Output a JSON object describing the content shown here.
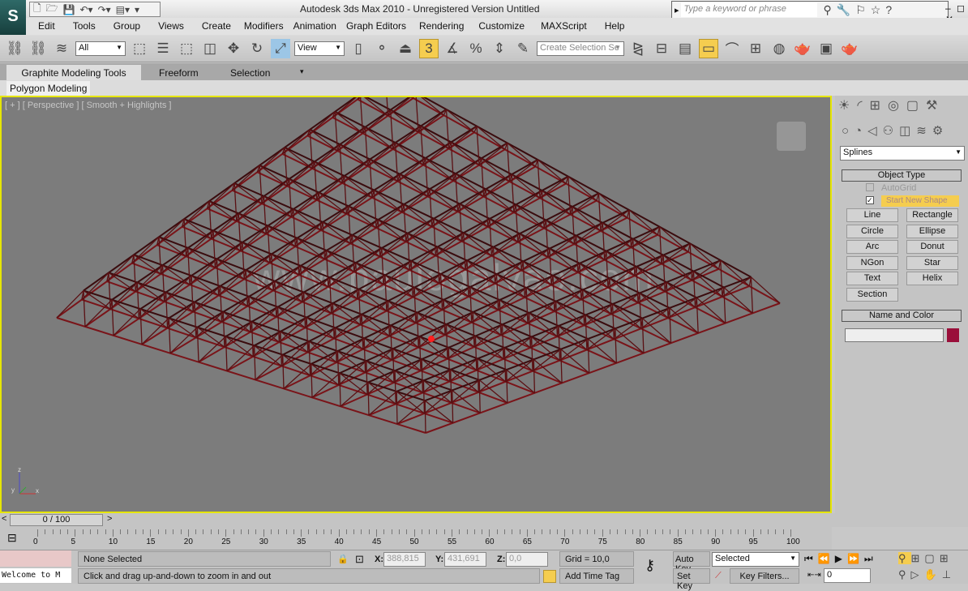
{
  "app": {
    "logo_text": "S",
    "title": "Autodesk 3ds Max  2010  -  Unregistered Version    Untitled",
    "search_placeholder": "Type a keyword or phrase",
    "window_controls": "–  ◻  ✕"
  },
  "quick_access": [
    "new-icon",
    "open-icon",
    "save-icon",
    "undo-icon",
    "redo-icon",
    "project-icon"
  ],
  "menu": [
    "Edit",
    "Tools",
    "Group",
    "Views",
    "Create",
    "Modifiers",
    "Animation",
    "Graph Editors",
    "Rendering",
    "Customize",
    "MAXScript",
    "Help"
  ],
  "toolbar": {
    "selection_filter": "All",
    "ref_coord": "View",
    "snap_label": "3",
    "named_selection_placeholder": "Create Selection Se"
  },
  "ribbon": {
    "tabs": [
      "Graphite Modeling Tools",
      "Freeform",
      "Selection"
    ],
    "panel": "Polygon Modeling"
  },
  "viewport": {
    "label": "[ + ] [ Perspective ] [ Smooth + Highlights ]",
    "watermark": "www.paulogalvao.com",
    "frame_color": "#7a1419",
    "axis": {
      "z": "z",
      "y": "y",
      "x": "x"
    }
  },
  "command_panel": {
    "category": "Splines",
    "object_type": {
      "header": "Object Type",
      "autogrid": "AutoGrid",
      "start_new_shape": "Start New Shape",
      "start_new_shape_checked": true,
      "buttons": [
        "Line",
        "Rectangle",
        "Circle",
        "Ellipse",
        "Arc",
        "Donut",
        "NGon",
        "Star",
        "Text",
        "Helix",
        "Section"
      ]
    },
    "name_color": {
      "header": "Name and Color",
      "name_value": "",
      "color": "#9a0f3a"
    }
  },
  "timeline": {
    "frame": "0 / 100",
    "prev": "<",
    "next": ">",
    "ticks": [
      "0",
      "5",
      "10",
      "15",
      "20",
      "25",
      "30",
      "35",
      "40",
      "45",
      "50",
      "55",
      "60",
      "65",
      "70",
      "75",
      "80",
      "85",
      "90",
      "95",
      "100"
    ]
  },
  "status": {
    "maxscript": "Welcome to M",
    "selection": "None Selected",
    "prompt": "Click and drag up-and-down to zoom in and out",
    "x": "388,815",
    "y": "431,691",
    "z": "0,0",
    "x_label": "X:",
    "y_label": "Y:",
    "z_label": "Z:",
    "grid": "Grid = 10,0",
    "add_time_tag": "Add Time Tag",
    "auto_key": "Auto Key",
    "set_key": "Set Key",
    "key_mode": "Selected",
    "key_filters": "Key Filters...",
    "current_frame": "0"
  }
}
